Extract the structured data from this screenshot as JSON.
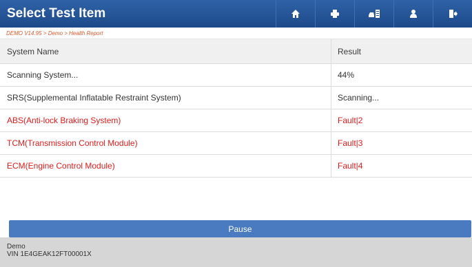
{
  "header": {
    "title": "Select Test Item",
    "icons": [
      "home-icon",
      "print-icon",
      "car-report-icon",
      "user-icon",
      "exit-icon"
    ]
  },
  "breadcrumb": "DEMO V14.95 > Demo > Health Report",
  "table": {
    "columns": [
      "System Name",
      "Result"
    ],
    "rows": [
      {
        "name": "Scanning System...",
        "result": "44%"
      },
      {
        "name": "SRS(Supplemental Inflatable Restraint System)",
        "result": "Scanning..."
      },
      {
        "name": "ABS(Anti-lock Braking System)",
        "result": "Fault|2"
      },
      {
        "name": "TCM(Transmission Control Module)",
        "result": "Fault|3"
      },
      {
        "name": "ECM(Engine Control Module)",
        "result": "Fault|4"
      }
    ]
  },
  "pause_label": "Pause",
  "footer": {
    "line1": "Demo",
    "line2": "VIN 1E4GEAK12FT00001X"
  },
  "colors": {
    "header_bg": "#1d4a8a",
    "fault_text": "#e11b1b",
    "pause_bg": "#4a7bc0",
    "footer_bg": "#d6d6d6"
  }
}
